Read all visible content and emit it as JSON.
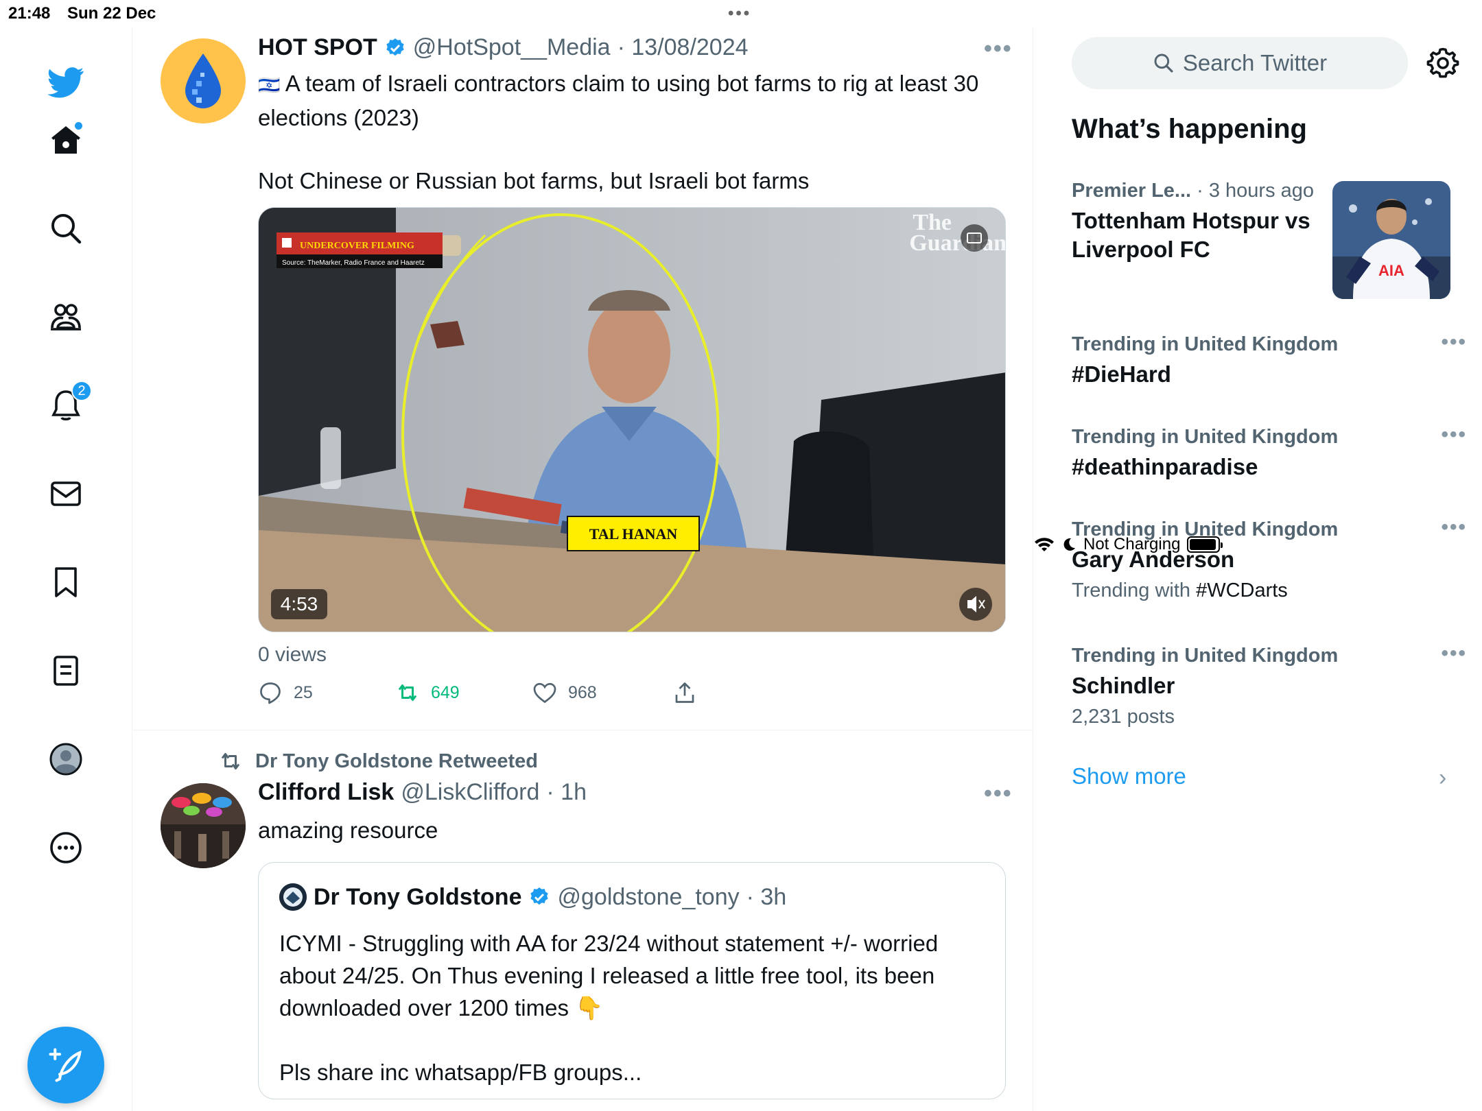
{
  "status_bar": {
    "time": "21:48",
    "date": "Sun 22 Dec",
    "charging": "Not Charging",
    "battery_level": 0.85
  },
  "sidebar": {
    "items": [
      {
        "name": "twitter-logo",
        "icon": "twitter-bird-icon"
      },
      {
        "name": "home",
        "icon": "home-icon",
        "has_dot": true
      },
      {
        "name": "explore",
        "icon": "search-icon"
      },
      {
        "name": "communities",
        "icon": "communities-icon"
      },
      {
        "name": "notifications",
        "icon": "bell-icon",
        "badge": "2"
      },
      {
        "name": "messages",
        "icon": "mail-icon"
      },
      {
        "name": "bookmarks",
        "icon": "bookmark-icon"
      },
      {
        "name": "lists",
        "icon": "list-icon"
      },
      {
        "name": "profile",
        "icon": "avatar-icon"
      },
      {
        "name": "more",
        "icon": "more-circle-icon"
      }
    ],
    "compose_icon": "compose-feather-icon"
  },
  "tweets": [
    {
      "name": "HOT SPOT",
      "handle": "@HotSpot__Media",
      "date": "· 13/08/2024",
      "verified": true,
      "flag": "🇮🇱",
      "text_line1": "A team of Israeli contractors claim to using bot farms to rig at least 30 elections (2023)",
      "text_line2": "Not Chinese or Russian bot farms, but Israeli bot farms",
      "media": {
        "banner": "UNDERCOVER FILMING",
        "source": "Source: TheMarker, Radio France and Haaretz",
        "watermark_line1": "The",
        "watermark_line2": "Guardian",
        "caption": "TAL HANAN",
        "duration": "4:53"
      },
      "views": "0 views",
      "replies": "25",
      "retweets": "649",
      "likes": "968"
    },
    {
      "retweeted_by": "Dr Tony Goldstone Retweeted",
      "name": "Clifford Lisk",
      "handle": "@LiskClifford",
      "time": "· 1h",
      "text": "amazing resource",
      "quote": {
        "name": "Dr Tony Goldstone",
        "handle": "@goldstone_tony",
        "time": "· 3h",
        "verified": true,
        "text_line1": "ICYMI - Struggling with AA for 23/24 without statement +/- worried about 24/25. On Thus evening I released a little free tool, its been downloaded over 1200 times",
        "emoji": "👇",
        "text_line2": "Pls share inc whatsapp/FB groups..."
      }
    }
  ],
  "right": {
    "search_placeholder": "Search Twitter",
    "section_title": "What’s happening",
    "trends": [
      {
        "category": "Premier Le...",
        "time": " · 3 hours ago",
        "title": "Tottenham Hotspur vs Liverpool FC",
        "has_image": true
      },
      {
        "category": "Trending in United Kingdom",
        "title": "#DieHard"
      },
      {
        "category": "Trending in United Kingdom",
        "title": "#deathinparadise"
      },
      {
        "category": "Trending in United Kingdom",
        "title": "Gary Anderson",
        "sub_prefix": "Trending with ",
        "sub_link": "#WCDarts"
      },
      {
        "category": "Trending in United Kingdom",
        "title": "Schindler",
        "sub": "2,231 posts"
      }
    ],
    "show_more": "Show more"
  },
  "colors": {
    "accent": "#1d9bf0",
    "retweet_green": "#00ba7c",
    "text_primary": "#0f1419",
    "text_secondary": "#536471"
  }
}
